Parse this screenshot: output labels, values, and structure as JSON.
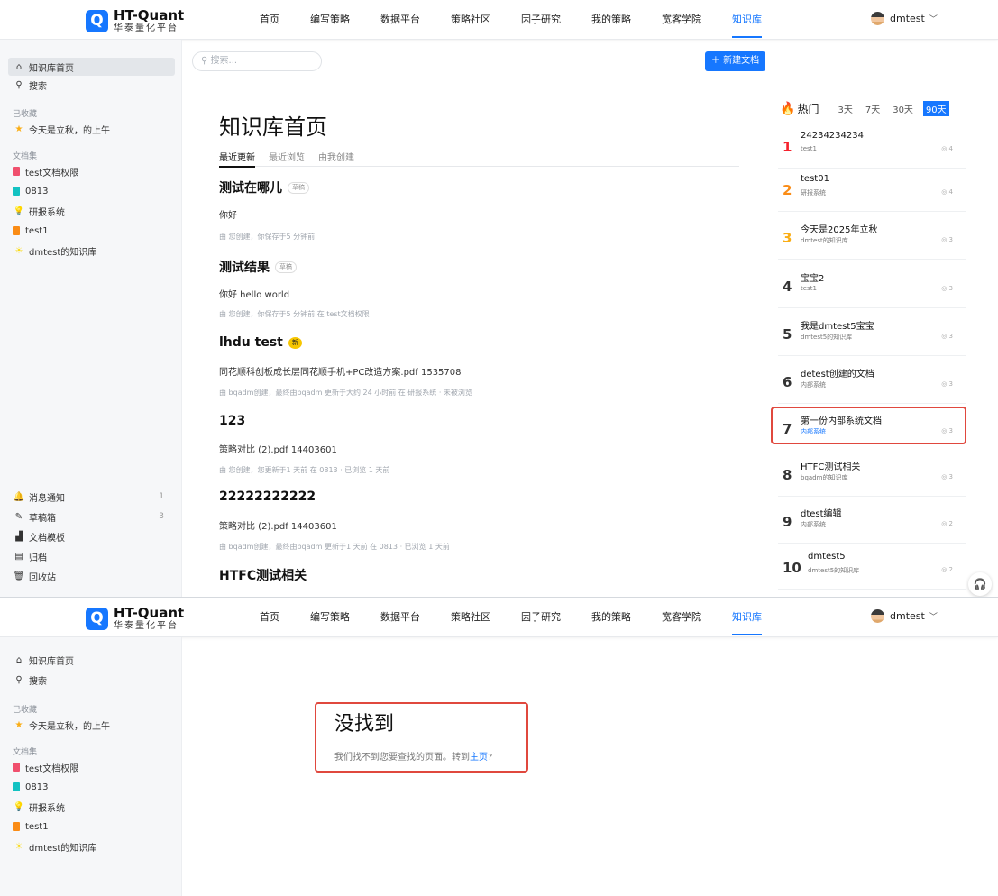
{
  "app": {
    "brand": "HT-Quant",
    "brand_cn": "华泰量化平台",
    "logo_glyph": "Q",
    "accent": "#1677ff",
    "highlight": "#e0483e"
  },
  "nav": [
    "首页",
    "编写策略",
    "数据平台",
    "策略社区",
    "因子研究",
    "我的策略",
    "宽客学院",
    "知识库"
  ],
  "user": {
    "name": "dmtest"
  },
  "sidebar": {
    "home": "知识库首页",
    "search": "搜索",
    "fav_label": "已收藏",
    "fav_item": "今天是立秋，的上午",
    "books_label": "文档集",
    "books": [
      {
        "name": "test文档权限",
        "color": "#f0506e"
      },
      {
        "name": "0813",
        "color": "#13c2c2"
      },
      {
        "name": "研报系统",
        "color": "#faad14"
      },
      {
        "name": "test1",
        "color": "#fa8c16"
      },
      {
        "name": "dmtest的知识库",
        "color": "#fadb14"
      }
    ],
    "bottom": [
      {
        "label": "消息通知",
        "count": "1",
        "icon": "bell-icon"
      },
      {
        "label": "草稿箱",
        "count": "3",
        "icon": "pen-icon"
      },
      {
        "label": "文档模板",
        "count": "",
        "icon": "template-icon"
      },
      {
        "label": "归档",
        "count": "",
        "icon": "archive-icon"
      },
      {
        "label": "回收站",
        "count": "",
        "icon": "trash-icon"
      }
    ]
  },
  "main": {
    "search_placeholder": "搜索...",
    "new_doc": "新建文档",
    "title": "知识库首页",
    "tabs": [
      "最近更新",
      "最近浏览",
      "由我创建"
    ],
    "docs": [
      {
        "title": "测试在哪儿",
        "tag": "草稿",
        "summary": "你好",
        "meta": "由 您创建，你保存于5 分钟前"
      },
      {
        "title": "测试结果",
        "tag": "草稿",
        "summary": "你好 hello world",
        "meta": "由 您创建，你保存于5 分钟前 在 test文档权限"
      },
      {
        "title": "lhdu test",
        "tag": "新",
        "summary": "同花顺科创板成长层同花顺手机+PC改造方案.pdf 1535708",
        "meta": "由 bqadm创建，最终由bqadm 更新于大约 24 小时前 在 研报系统 · 未被浏览"
      },
      {
        "title": "123",
        "tag": "",
        "summary": "策略对比 (2).pdf 14403601",
        "meta": "由 您创建，您更新于1 天前 在 0813 · 已浏览 1 天前"
      },
      {
        "title": "22222222222",
        "tag": "",
        "summary": "策略对比 (2).pdf 14403601",
        "meta": "由 bqadm创建，最终由bqadm 更新于1 天前 在 0813 · 已浏览 1 天前"
      },
      {
        "title": "HTFC测试相关",
        "tag": "",
        "summary": "",
        "meta": ""
      }
    ]
  },
  "hot": {
    "title": "热门",
    "ranges": [
      "3天",
      "7天",
      "30天",
      "90天"
    ],
    "selected_range": "90天",
    "items": [
      {
        "rank": "1",
        "title": "24234234234",
        "space": "test1",
        "views": "4"
      },
      {
        "rank": "2",
        "title": "test01",
        "space": "研报系统",
        "views": "4"
      },
      {
        "rank": "3",
        "title": "今天是2025年立秋",
        "space": "dmtest的知识库",
        "views": "3"
      },
      {
        "rank": "4",
        "title": "宝宝2",
        "space": "test1",
        "views": "3"
      },
      {
        "rank": "5",
        "title": "我是dmtest5宝宝",
        "space": "dmtest5的知识库",
        "views": "3"
      },
      {
        "rank": "6",
        "title": "detest创建的文档",
        "space": "内部系统",
        "views": "3"
      },
      {
        "rank": "7",
        "title": "第一份内部系统文档",
        "space": "内部系统",
        "views": "3"
      },
      {
        "rank": "8",
        "title": "HTFC测试相关",
        "space": "bqadm的知识库",
        "views": "3"
      },
      {
        "rank": "9",
        "title": "dtest编辑",
        "space": "内部系统",
        "views": "2"
      },
      {
        "rank": "10",
        "title": "dmtest5",
        "space": "dmtest5的知识库",
        "views": "2"
      }
    ]
  },
  "not_found": {
    "title": "没找到",
    "text": "我们找不到您要查找的页面。转到",
    "link": "主页",
    "suffix": "?"
  }
}
